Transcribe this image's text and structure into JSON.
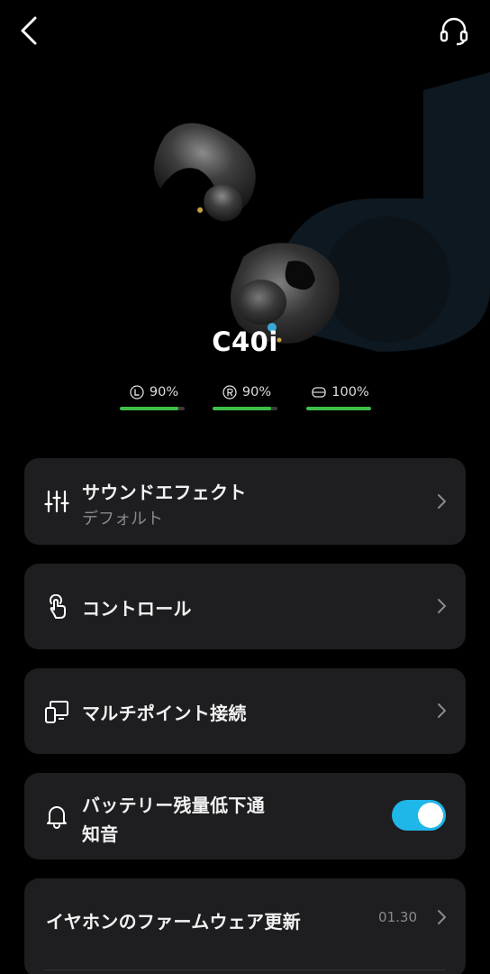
{
  "header": {
    "back_icon": "chevron-left-icon",
    "support_icon": "headset-icon"
  },
  "device": {
    "name": "C40i"
  },
  "battery": {
    "left": {
      "icon": "left-earbud-icon",
      "text": "90%",
      "level": 0.9
    },
    "right": {
      "icon": "right-earbud-icon",
      "text": "90%",
      "level": 0.9
    },
    "case": {
      "icon": "charging-case-icon",
      "text": "100%",
      "level": 1.0
    },
    "fill_color": "#3fbf4a"
  },
  "menu": {
    "sound_effect": {
      "title": "サウンドエフェクト",
      "subtitle": "デフォルト",
      "icon": "equalizer-icon"
    },
    "control": {
      "title": "コントロール",
      "icon": "touch-gesture-icon"
    },
    "multipoint": {
      "title": "マルチポイント接続",
      "icon": "multi-device-icon"
    },
    "low_battery": {
      "title_line1": "バッテリー残量低下通",
      "title_line2": "知音",
      "icon": "bell-icon",
      "enabled": true
    },
    "firmware": {
      "title": "イヤホンのファームウェア更新",
      "version": "01.30"
    }
  },
  "colors": {
    "background": "#000000",
    "card": "#1e1e20",
    "accent": "#1fb6e8"
  }
}
